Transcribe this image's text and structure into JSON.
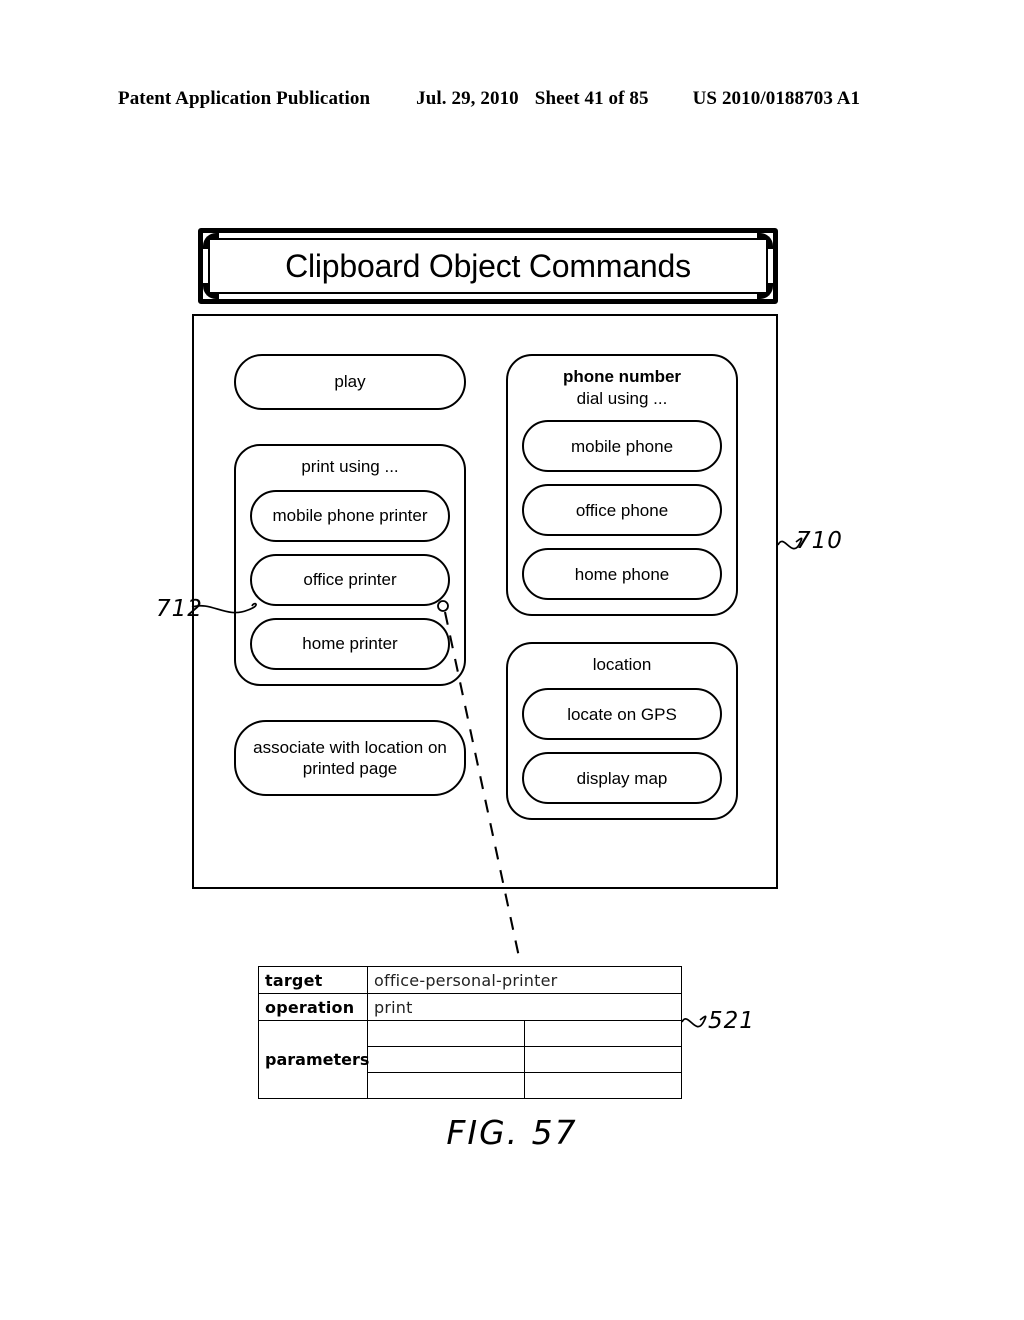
{
  "page_header": {
    "publication": "Patent Application Publication",
    "date": "Jul. 29, 2010",
    "sheet": "Sheet 41 of 85",
    "patent_number": "US 2010/0188703 A1"
  },
  "figure": {
    "caption": "FIG. 57",
    "title": "Clipboard Object Commands",
    "reference_numerals": {
      "panel": "710",
      "office_printer_button": "712",
      "command_table": "521"
    }
  },
  "panel": {
    "left_column": {
      "play_button": "play",
      "print_group": {
        "title": "print using ...",
        "options": [
          "mobile phone printer",
          "office printer",
          "home printer"
        ]
      },
      "associate_button": "associate with location on\nprinted page",
      "associate_button_line1": "associate with location on",
      "associate_button_line2": "printed page"
    },
    "right_column": {
      "phone_group": {
        "title": "phone number",
        "subtitle": "dial using ...",
        "options": [
          "mobile phone",
          "office phone",
          "home phone"
        ]
      },
      "location_group": {
        "title": "location",
        "options": [
          "locate on GPS",
          "display map"
        ]
      }
    }
  },
  "command_table": {
    "rows": [
      {
        "key": "target",
        "value": "office-personal-printer"
      },
      {
        "key": "operation",
        "value": "print"
      }
    ],
    "parameters_label": "parameters",
    "parameter_rows": [
      {
        "name": "",
        "value": ""
      },
      {
        "name": "",
        "value": ""
      },
      {
        "name": "",
        "value": ""
      }
    ]
  },
  "colors": {
    "ink": "#000000",
    "paper": "#ffffff"
  }
}
